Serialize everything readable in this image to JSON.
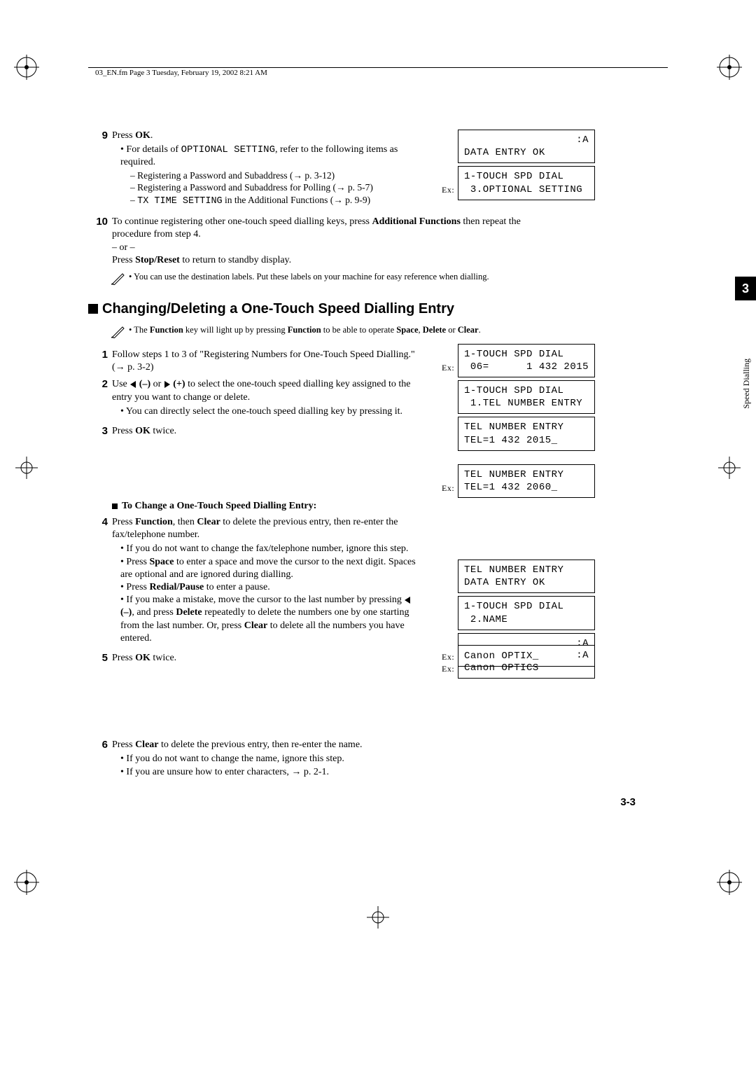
{
  "header": "03_EN.fm  Page 3  Tuesday, February 19, 2002  8:21 AM",
  "chapter_tab": "3",
  "side_label": "Speed Dialling",
  "page_number": "3-3",
  "step9": {
    "num": "9",
    "line": "Press OK.",
    "bullet1_pre": "For details of ",
    "optional_setting": "OPTIONAL SETTING",
    "bullet1_post": ", refer to the following items as required.",
    "sub1": "– Registering a Password and Subaddress (→ p. 3-12)",
    "sub2": "– Registering a Password and Subaddress for Polling (→ p. 5-7)",
    "sub3_txtime": "TX TIME SETTING",
    "sub3_rest": " in the Additional Functions (→ p. 9-9)"
  },
  "lcd9": {
    "box1_l1": "",
    "box1_l2": "DATA ENTRY OK",
    "box1_a": ":A",
    "box2_l1": "1-TOUCH SPD DIAL",
    "box2_l2": " 3.OPTIONAL SETTING",
    "ex": "Ex:"
  },
  "step10": {
    "num": "10",
    "line_pre": "To continue registering other one-touch speed dialling keys, press ",
    "af": "Additional Functions",
    "line_post1": " then repeat the procedure from step 4.",
    "or": "– or –",
    "line2_pre": "Press ",
    "sr": "Stop/Reset",
    "line2_post": " to return to standby display."
  },
  "note10": "You can use the destination labels. Put these labels on your machine for easy reference when dialling.",
  "heading2": "Changing/Deleting a One-Touch Speed Dialling Entry",
  "note_heading": {
    "pre": "The ",
    "f1": "Function",
    "mid": " key will light up by pressing ",
    "f2": "Function",
    "mid2": " to be able to operate ",
    "space": "Space",
    "c1": ", ",
    "delete": "Delete",
    "or": " or ",
    "clear": "Clear",
    "end": "."
  },
  "step1": {
    "num": "1",
    "text": "Follow steps 1 to 3 of \"Registering Numbers for One-Touch Speed Dialling.\" (→ p. 3-2)"
  },
  "step2": {
    "num": "2",
    "pre": "Use ",
    "minus": " (–)",
    "or": " or ",
    "plus": " (+)",
    "post": " to select the one-touch speed dialling key assigned to the entry you want to change or delete.",
    "bullet": "You can directly select the one-touch speed dialling key by pressing it."
  },
  "lcd2": {
    "ex": "Ex:",
    "l1": "1-TOUCH SPD DIAL",
    "l2": " 06=      1 432 2015"
  },
  "step3": {
    "num": "3",
    "pre": "Press ",
    "ok": "OK",
    "post": " twice."
  },
  "lcd3": {
    "b1l1": "1-TOUCH SPD DIAL",
    "b1l2": " 1.TEL NUMBER ENTRY",
    "b2l1": "TEL NUMBER ENTRY",
    "b2l2": "TEL=1 432 2015_"
  },
  "subheading_change": "To Change a One-Touch Speed Dialling Entry:",
  "step4": {
    "num": "4",
    "pre": "Press ",
    "f": "Function",
    "mid": ", then ",
    "clear": "Clear",
    "post": " to delete the previous entry, then re-enter the fax/telephone number.",
    "b1": "If you do not want to change the fax/telephone number, ignore this step.",
    "b2_pre": "Press ",
    "b2_space": "Space",
    "b2_post": " to enter a space and move the cursor to the next digit. Spaces are optional and are ignored during dialling.",
    "b3_pre": "Press ",
    "b3_rp": "Redial/Pause",
    "b3_post": " to enter a pause.",
    "b4_pre": "If you make a mistake, move the cursor to the last number by pressing ",
    "b4_minus": " (–)",
    "b4_mid": ", and press ",
    "b4_del": "Delete",
    "b4_mid2": " repeatedly to delete the numbers one by one starting from the last number. Or, press ",
    "b4_clear": "Clear",
    "b4_post": " to delete all the numbers you have entered."
  },
  "lcd4": {
    "ex": "Ex:",
    "l1": "TEL NUMBER ENTRY",
    "l2": "TEL=1 432 2060_"
  },
  "step5": {
    "num": "5",
    "pre": "Press ",
    "ok": "OK",
    "post": " twice."
  },
  "lcd5": {
    "b1l1": "TEL NUMBER ENTRY",
    "b1l2": "DATA ENTRY OK",
    "b2l1": "1-TOUCH SPD DIAL",
    "b2l2": " 2.NAME",
    "b3_a": ":A",
    "b3l2": "Canon OPTIX_",
    "ex": "Ex:"
  },
  "step6": {
    "num": "6",
    "pre": "Press ",
    "clear": "Clear",
    "post": " to delete the previous entry, then re-enter the name.",
    "b1": "If you do not want to change the name, ignore this step.",
    "b2": "If you are unsure how to enter characters, → p. 2-1."
  },
  "lcd6": {
    "ex": "Ex:",
    "a": ":A",
    "l2": "Canon OPTICS"
  }
}
